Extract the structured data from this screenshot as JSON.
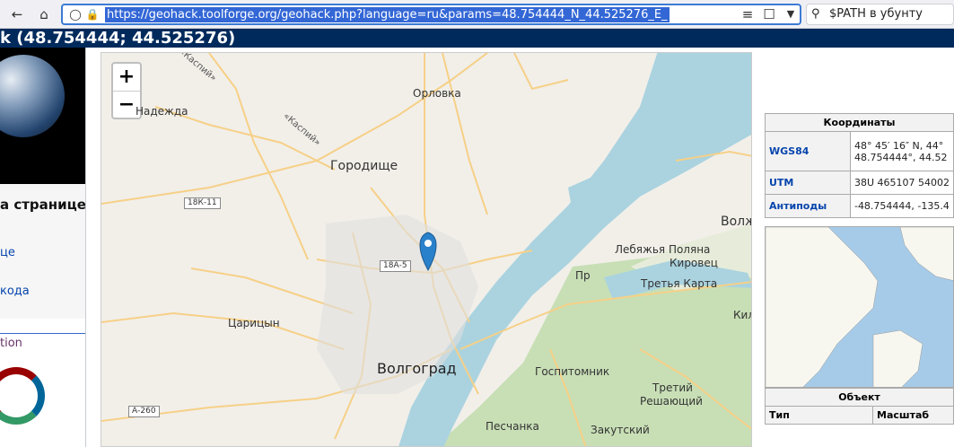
{
  "browser": {
    "url": "https://geohack.toolforge.org/geohack.php?language=ru&params=48.754444_N_44.525276_E_",
    "search_text": "$PATH в убунту",
    "icons": [
      "back-arrow-icon",
      "home-icon",
      "shield-icon",
      "lock-icon",
      "reader-icon",
      "bookmark-icon",
      "chevron-down-icon",
      "search-icon"
    ]
  },
  "page": {
    "title": "k (48.754444; 44.525276)"
  },
  "left": {
    "heading": "а странице",
    "links": [
      "це",
      "кода",
      "tion"
    ]
  },
  "map": {
    "zoom_in": "+",
    "zoom_out": "−",
    "labels": {
      "orlovka": "Орловка",
      "nadezhda": "Надежда",
      "gorodishche": "Городище",
      "tsaritsyn": "Царицын",
      "volgograd": "Волгоград",
      "lebyazhya": "Лебяжья Поляна",
      "kirovets": "Кировец",
      "tretya_karta": "Третья Карта",
      "gospitomnik": "Госпитомник",
      "tretiy": "Третий",
      "reshayushchiy": "Решающий",
      "peschanka": "Песчанка",
      "zakutskiy": "Закутский",
      "volzh": "Волж",
      "kil": "Кил",
      "pr": "Пр"
    },
    "shields": [
      "18К-11",
      "18А-5",
      "А-260"
    ],
    "rail": [
      "«Каспий»",
      "«Каспий»"
    ]
  },
  "coords": {
    "header": "Координаты",
    "rows": [
      {
        "label": "WGS84",
        "value1": "48° 45′ 16″ N, 44°",
        "value2": "48.754444°, 44.52"
      },
      {
        "label": "UTM",
        "value1": "38U 465107 54002",
        "value2": ""
      },
      {
        "label": "Антиподы",
        "value1": "-48.754444, -135.4",
        "value2": ""
      }
    ]
  },
  "object": {
    "header": "Объект",
    "col_type": "Тип",
    "col_scale": "Масштаб"
  },
  "colors": {
    "header_bg": "#002a5c",
    "water": "#aad3df",
    "park": "#c8dfb6",
    "road": "#f6d087",
    "marker": "#2a81cb"
  }
}
